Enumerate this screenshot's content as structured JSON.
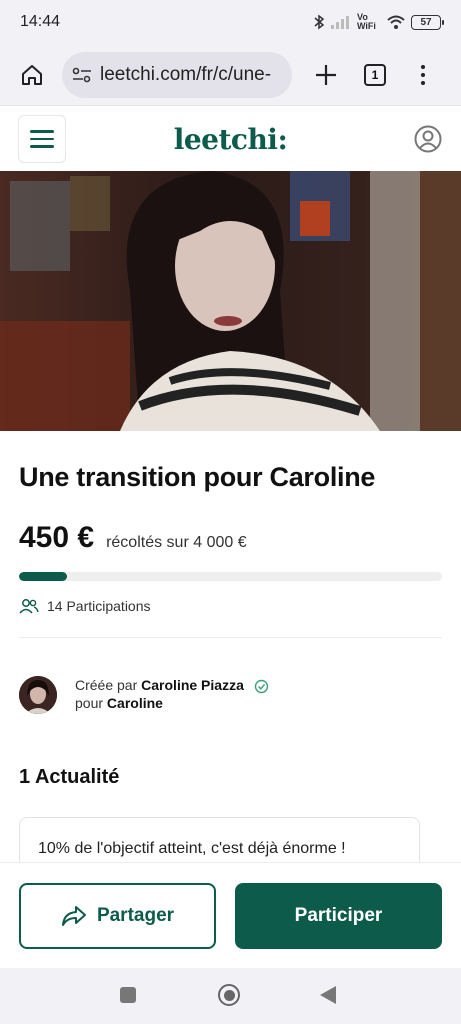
{
  "status_bar": {
    "time": "14:44",
    "network_label": "Vo WiFi",
    "battery": "57"
  },
  "browser": {
    "url": "leetchi.com/fr/c/une-",
    "tab_count": "1"
  },
  "site": {
    "logo": "leetchi:"
  },
  "campaign": {
    "title": "Une transition pour Caroline",
    "amount": "450 €",
    "amount_subtext": "récoltés sur 4 000 €",
    "progress_fraction": 0.1125,
    "participations": "14 Participations"
  },
  "creator": {
    "created_by_label": "Créée par",
    "creator_name": "Caroline Piazza",
    "for_label": "pour",
    "beneficiary": "Caroline"
  },
  "news": {
    "heading": "1 Actualité",
    "items": [
      {
        "text": "10% de l'objectif atteint, c'est déjà énorme !"
      }
    ]
  },
  "actions": {
    "share_label": "Partager",
    "participate_label": "Participer"
  },
  "colors": {
    "brand": "#0c5b4b",
    "verified": "#3aa07a"
  },
  "icons": {
    "home": "home-icon",
    "site_settings": "tune-icon",
    "new_tab": "plus-icon",
    "tabs": "tabs-icon",
    "menu": "more-vert-icon",
    "hamburger": "menu-icon",
    "account": "user-circle-icon",
    "participants": "people-icon",
    "verified": "check-circle-icon",
    "share": "share-arrow-icon"
  }
}
